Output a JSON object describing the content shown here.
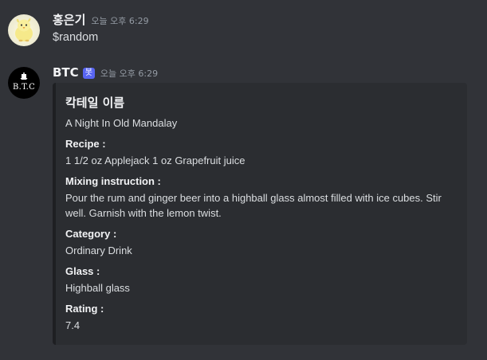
{
  "messages": [
    {
      "username": "홍은기",
      "timestamp": "오늘 오후 6:29",
      "avatar_icon": "chick-avatar",
      "text": "$random"
    },
    {
      "username": "BTC",
      "bot_tag": "봇",
      "timestamp": "오늘 오후 6:29",
      "avatar_icon": "btc-logo-avatar",
      "avatar_text": "B.T.C",
      "embed": {
        "title": "칵테일 이름",
        "description": "A Night In Old Mandalay",
        "fields": [
          {
            "name": "Recipe :",
            "value": "1 1/2 oz Applejack 1 oz Grapefruit juice"
          },
          {
            "name": "Mixing instruction :",
            "value": "Pour the rum and ginger beer into a highball glass almost filled with ice cubes. Stir well. Garnish with the lemon twist."
          },
          {
            "name": "Category :",
            "value": "Ordinary Drink"
          },
          {
            "name": "Glass :",
            "value": "Highball glass"
          },
          {
            "name": "Rating :",
            "value": "7.4"
          }
        ]
      }
    }
  ],
  "colors": {
    "background": "#313338",
    "embed_background": "#2b2d31",
    "embed_border": "#1e1f22",
    "bot_tag": "#5865f2",
    "timestamp": "#949ba4"
  }
}
